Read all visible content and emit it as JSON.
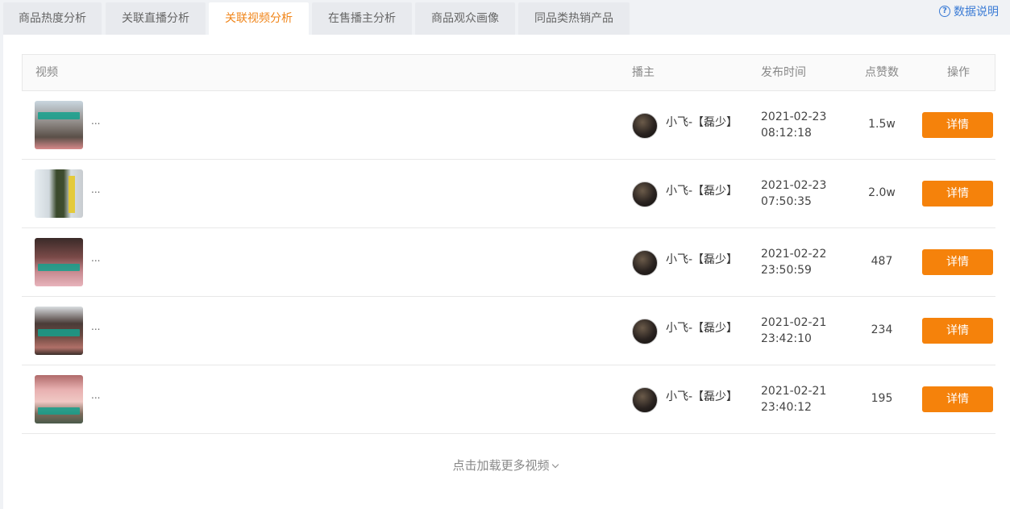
{
  "tabs": [
    {
      "label": "商品热度分析",
      "active": false
    },
    {
      "label": "关联直播分析",
      "active": false
    },
    {
      "label": "关联视频分析",
      "active": true
    },
    {
      "label": "在售播主分析",
      "active": false
    },
    {
      "label": "商品观众画像",
      "active": false
    },
    {
      "label": "同品类热销产品",
      "active": false
    }
  ],
  "help": {
    "label": "数据说明",
    "icon": "question-circle-icon"
  },
  "table": {
    "headers": {
      "video": "视频",
      "anchor": "播主",
      "publish_time": "发布时间",
      "likes": "点赞数",
      "action": "操作"
    },
    "rows": [
      {
        "title": "...",
        "anchor": "小飞-【磊少】",
        "date": "2021-02-23",
        "time": "08:12:18",
        "likes": "1.5w",
        "action": "详情"
      },
      {
        "title": "...",
        "anchor": "小飞-【磊少】",
        "date": "2021-02-23",
        "time": "07:50:35",
        "likes": "2.0w",
        "action": "详情"
      },
      {
        "title": "...",
        "anchor": "小飞-【磊少】",
        "date": "2021-02-22",
        "time": "23:50:59",
        "likes": "487",
        "action": "详情"
      },
      {
        "title": "...",
        "anchor": "小飞-【磊少】",
        "date": "2021-02-21",
        "time": "23:42:10",
        "likes": "234",
        "action": "详情"
      },
      {
        "title": "...",
        "anchor": "小飞-【磊少】",
        "date": "2021-02-21",
        "time": "23:40:12",
        "likes": "195",
        "action": "详情"
      }
    ]
  },
  "load_more": {
    "label": "点击加载更多视频",
    "icon": "chevron-down-icon"
  },
  "colors": {
    "accent": "#f5820b",
    "active_tab_text": "#f08519",
    "link": "#3a7bd5"
  }
}
